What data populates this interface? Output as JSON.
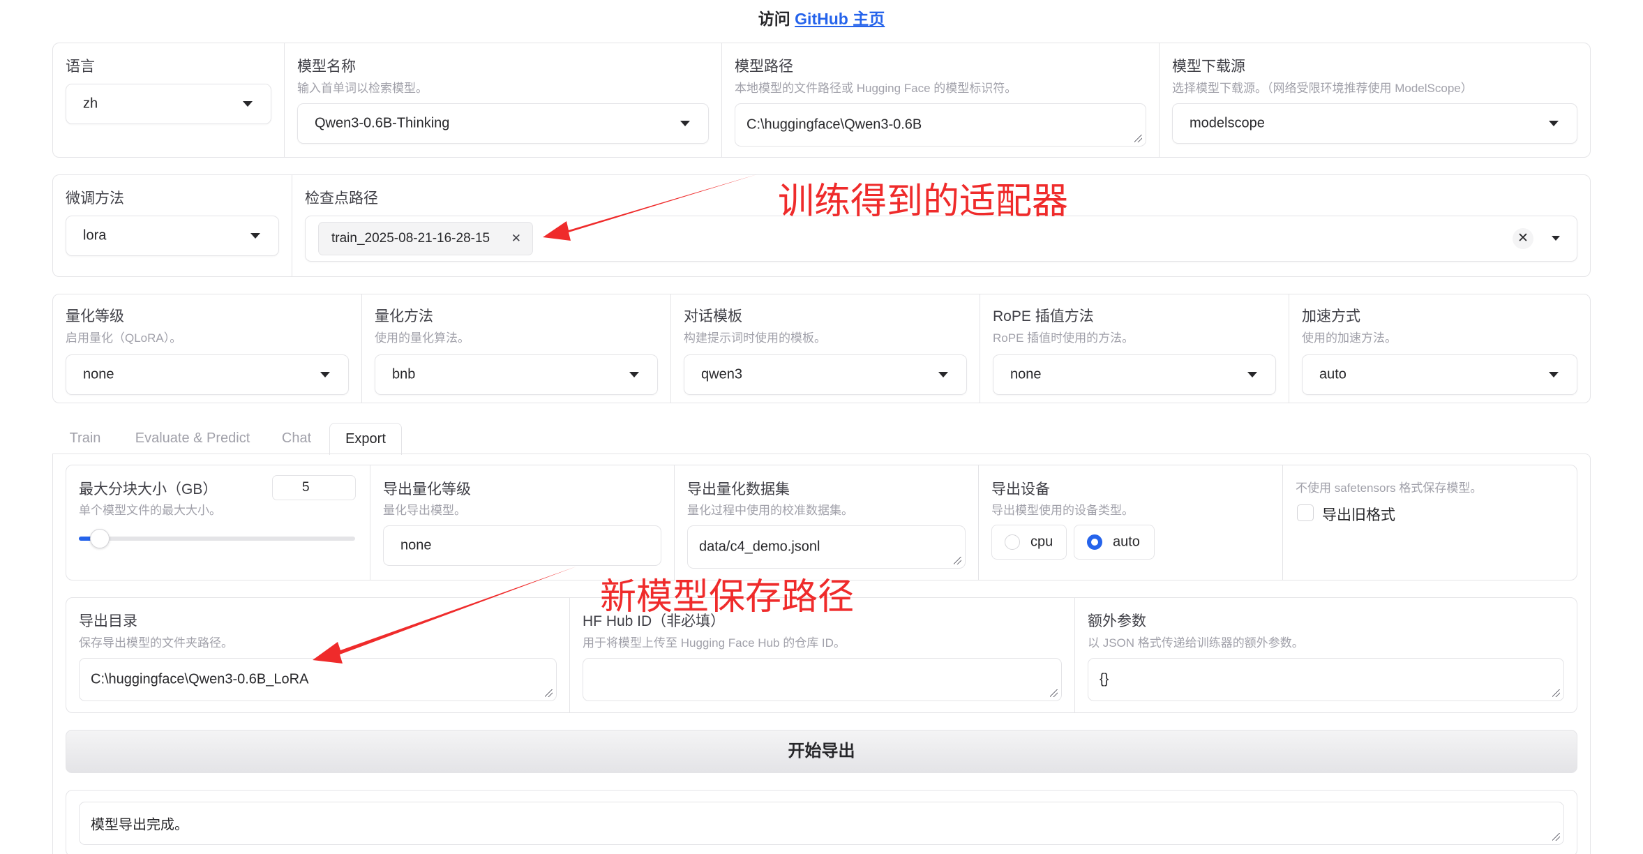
{
  "header": {
    "prefix": "访问",
    "link": "GitHub 主页"
  },
  "top": {
    "lang": {
      "label": "语言",
      "value": "zh"
    },
    "model_name": {
      "label": "模型名称",
      "info": "输入首单词以检索模型。",
      "value": "Qwen3-0.6B-Thinking"
    },
    "model_path": {
      "label": "模型路径",
      "info": "本地模型的文件路径或 Hugging Face 的模型标识符。",
      "value": "C:\\huggingface\\Qwen3-0.6B"
    },
    "hub": {
      "label": "模型下载源",
      "info": "选择模型下载源。（网络受限环境推荐使用 ModelScope）",
      "value": "modelscope"
    }
  },
  "finetune": {
    "method": {
      "label": "微调方法",
      "value": "lora"
    },
    "checkpoint": {
      "label": "检查点路径",
      "chip": "train_2025-08-21-16-28-15"
    }
  },
  "settings": {
    "quant_bit": {
      "label": "量化等级",
      "info": "启用量化（QLoRA）。",
      "value": "none"
    },
    "quant_method": {
      "label": "量化方法",
      "info": "使用的量化算法。",
      "value": "bnb"
    },
    "template": {
      "label": "对话模板",
      "info": "构建提示词时使用的模板。",
      "value": "qwen3"
    },
    "rope": {
      "label": "RoPE 插值方法",
      "info": "RoPE 插值时使用的方法。",
      "value": "none"
    },
    "booster": {
      "label": "加速方式",
      "info": "使用的加速方法。",
      "value": "auto"
    }
  },
  "tabs": [
    "Train",
    "Evaluate & Predict",
    "Chat",
    "Export"
  ],
  "export": {
    "shard": {
      "label": "最大分块大小（GB）",
      "info": "单个模型文件的最大大小。",
      "value": "5",
      "fraction": 0.05
    },
    "quant_bit": {
      "label": "导出量化等级",
      "info": "量化导出模型。",
      "value": "none"
    },
    "quant_dataset": {
      "label": "导出量化数据集",
      "info": "量化过程中使用的校准数据集。",
      "value": "data/c4_demo.jsonl"
    },
    "device": {
      "label": "导出设备",
      "info": "导出模型使用的设备类型。",
      "options": [
        "cpu",
        "auto"
      ],
      "selected": "auto"
    },
    "legacy": {
      "info": "不使用 safetensors 格式保存模型。",
      "label": "导出旧格式",
      "checked": false
    },
    "dir": {
      "label": "导出目录",
      "info": "保存导出模型的文件夹路径。",
      "value": "C:\\huggingface\\Qwen3-0.6B_LoRA"
    },
    "hub_id": {
      "label": "HF Hub ID（非必填）",
      "info": "用于将模型上传至 Hugging Face Hub 的仓库 ID。",
      "value": ""
    },
    "extra": {
      "label": "额外参数",
      "info": "以 JSON 格式传递给训练器的额外参数。",
      "value": "{}"
    },
    "button": "开始导出",
    "output": "模型导出完成。"
  },
  "annotations": {
    "adapter": "训练得到的适配器",
    "save_path": "新模型保存路径"
  },
  "colors": {
    "accent": "#2563eb",
    "annotation": "#ef2b2b",
    "border": "#e4e4e7"
  }
}
